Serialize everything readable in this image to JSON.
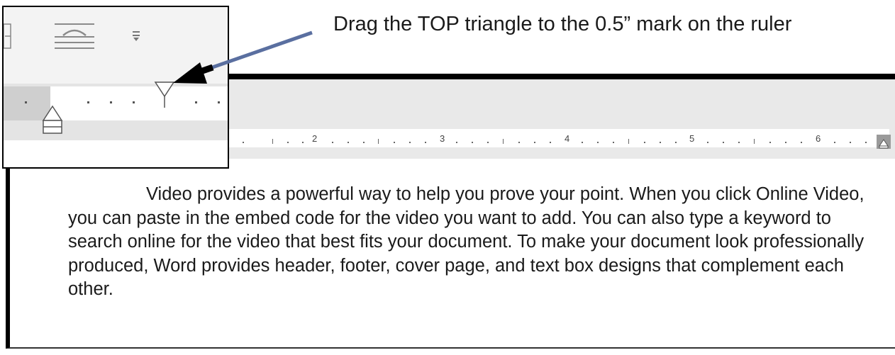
{
  "instruction": "Drag the TOP triangle to the 0.5” mark on the ruler",
  "ruler": {
    "labels": [
      "2",
      "3",
      "4",
      "5",
      "6"
    ]
  },
  "document": {
    "paragraph": "Video provides a powerful way to help you prove your point. When you click Online Video, you can paste in the embed code for the video you want to add. You can also type a keyword to search online for the video that best fits your document. To make your document look professionally produced, Word provides header, footer, cover page, and text box designs that complement each other."
  },
  "icons": {
    "ribbon_left": "line-spacing-icon",
    "ribbon_mid": "paragraph-align-icon",
    "ribbon_right": "dropdown-chevron-icon",
    "first_line_indent": "first-line-indent-marker-icon",
    "hanging_indent": "hanging-indent-marker-icon",
    "right_indent": "right-indent-marker-icon",
    "arrow": "callout-arrow-icon"
  },
  "colors": {
    "arrow": "#000000",
    "frame": "#000000",
    "ruler_bg": "#e9e9e9"
  }
}
